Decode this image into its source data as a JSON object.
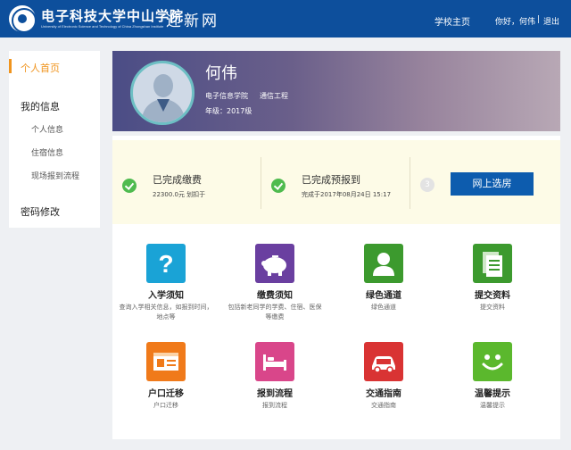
{
  "header": {
    "school_name": "电子科技大学中山学院",
    "school_name_en": "University of Electronic Science and Technology of China Zhongshan Institute",
    "site_name": "迎新网",
    "nav_home": "学校主页",
    "greeting": "你好，何伟",
    "separator": "|",
    "logout": "退出",
    "colors": {
      "bar": "#0d4f9c",
      "accent": "#f0941e"
    }
  },
  "sidebar": {
    "home": "个人首页",
    "my_info": "我的信息",
    "personal_info": "个人信息",
    "lodging_info": "住宿信息",
    "onsite_process": "现场报到流程",
    "password": "密码修改"
  },
  "profile": {
    "name": "何伟",
    "college": "电子信息学院",
    "major": "通信工程",
    "grade": "年级：2017级"
  },
  "status": {
    "payment_title": "已完成缴费",
    "payment_detail": "22300.0元 划扣于",
    "prereg_title": "已完成预报到",
    "prereg_detail": "完成于2017年08月24日 15:17",
    "step_three": "3",
    "room_button": "网上选房"
  },
  "features": [
    {
      "title": "入学须知",
      "desc": "查询入学相关信息，如报到时间，地点等",
      "icon": "question-icon",
      "color": "#1aa3d6"
    },
    {
      "title": "缴费须知",
      "desc": "包括新老同学的学费、住宿、医保等缴费",
      "icon": "piggy-bank-icon",
      "color": "#6a3fa0"
    },
    {
      "title": "绿色通道",
      "desc": "绿色通道",
      "icon": "person-icon",
      "color": "#3c9a2e"
    },
    {
      "title": "提交资料",
      "desc": "提交资料",
      "icon": "documents-icon",
      "color": "#3c9a2e"
    },
    {
      "title": "户口迁移",
      "desc": "户口迁移",
      "icon": "id-card-icon",
      "color": "#f07a1a"
    },
    {
      "title": "报到流程",
      "desc": "报到流程",
      "icon": "bed-icon",
      "color": "#d9468a"
    },
    {
      "title": "交通指南",
      "desc": "交通指南",
      "icon": "car-icon",
      "color": "#d93333"
    },
    {
      "title": "温馨提示",
      "desc": "温馨提示",
      "icon": "smiley-icon",
      "color": "#5bb82d"
    }
  ]
}
